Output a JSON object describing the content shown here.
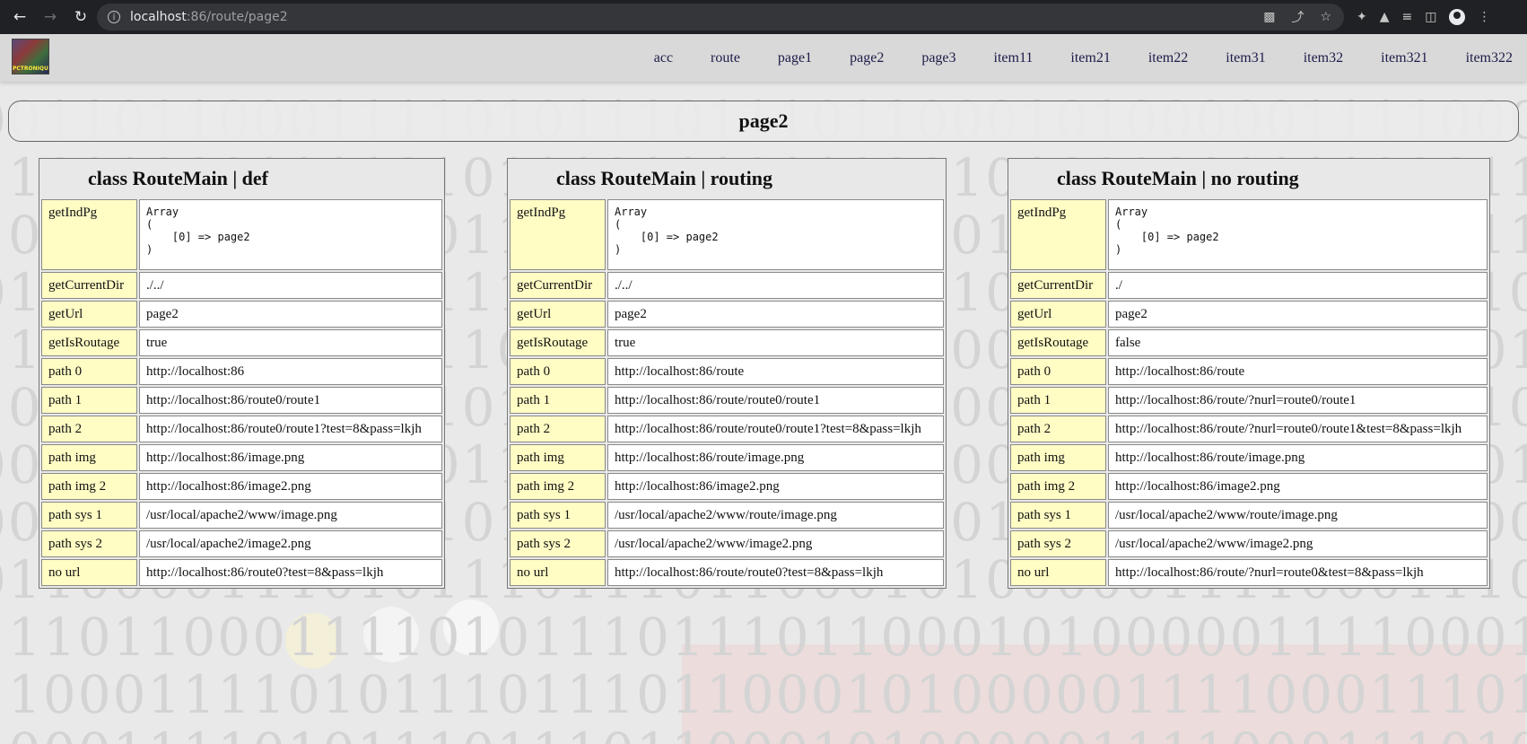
{
  "browser": {
    "url_host": "localhost",
    "url_rest": ":86/route/page2",
    "icons": [
      "back-arrow-icon",
      "forward-arrow-icon",
      "reload-icon",
      "info-icon",
      "translate-icon",
      "share-icon",
      "star-icon",
      "extensions-icon",
      "lab-icon",
      "reading-list-icon",
      "side-panel-icon",
      "profile-icon",
      "more-icon"
    ]
  },
  "header": {
    "logo_text": "PCTRONIQUE",
    "menu": [
      "acc",
      "route",
      "page1",
      "page2",
      "page3",
      "item11",
      "item21",
      "item22",
      "item31",
      "item32",
      "item321",
      "item322"
    ]
  },
  "page_title": "page2",
  "panels": [
    {
      "title": "class RouteMain | def",
      "array": "Array\n(\n    [0] => page2\n)",
      "rows": [
        {
          "key": "getCurrentDir",
          "value": "./../"
        },
        {
          "key": "getUrl",
          "value": "page2"
        },
        {
          "key": "getIsRoutage",
          "value": "true"
        },
        {
          "key": "path 0",
          "value": "http://localhost:86"
        },
        {
          "key": "path 1",
          "value": "http://localhost:86/route0/route1"
        },
        {
          "key": "path 2",
          "value": "http://localhost:86/route0/route1?test=8&pass=lkjh"
        },
        {
          "key": "path img",
          "value": "http://localhost:86/image.png"
        },
        {
          "key": "path img 2",
          "value": "http://localhost:86/image2.png"
        },
        {
          "key": "path sys 1",
          "value": "/usr/local/apache2/www/image.png"
        },
        {
          "key": "path sys 2",
          "value": "/usr/local/apache2/image2.png"
        },
        {
          "key": "no url",
          "value": "http://localhost:86/route0?test=8&pass=lkjh"
        }
      ]
    },
    {
      "title": "class RouteMain | routing",
      "array": "Array\n(\n    [0] => page2\n)",
      "rows": [
        {
          "key": "getCurrentDir",
          "value": "./../"
        },
        {
          "key": "getUrl",
          "value": "page2"
        },
        {
          "key": "getIsRoutage",
          "value": "true"
        },
        {
          "key": "path 0",
          "value": "http://localhost:86/route"
        },
        {
          "key": "path 1",
          "value": "http://localhost:86/route/route0/route1"
        },
        {
          "key": "path 2",
          "value": "http://localhost:86/route/route0/route1?test=8&pass=lkjh"
        },
        {
          "key": "path img",
          "value": "http://localhost:86/route/image.png"
        },
        {
          "key": "path img 2",
          "value": "http://localhost:86/image2.png"
        },
        {
          "key": "path sys 1",
          "value": "/usr/local/apache2/www/route/image.png"
        },
        {
          "key": "path sys 2",
          "value": "/usr/local/apache2/www/image2.png"
        },
        {
          "key": "no url",
          "value": "http://localhost:86/route/route0?test=8&pass=lkjh"
        }
      ]
    },
    {
      "title": "class RouteMain | no routing",
      "array": "Array\n(\n    [0] => page2\n)",
      "rows": [
        {
          "key": "getCurrentDir",
          "value": "./"
        },
        {
          "key": "getUrl",
          "value": "page2"
        },
        {
          "key": "getIsRoutage",
          "value": "false"
        },
        {
          "key": "path 0",
          "value": "http://localhost:86/route"
        },
        {
          "key": "path 1",
          "value": "http://localhost:86/route/?nurl=route0/route1"
        },
        {
          "key": "path 2",
          "value": "http://localhost:86/route/?nurl=route0/route1&test=8&pass=lkjh"
        },
        {
          "key": "path img",
          "value": "http://localhost:86/route/image.png"
        },
        {
          "key": "path img 2",
          "value": "http://localhost:86/image2.png"
        },
        {
          "key": "path sys 1",
          "value": "/usr/local/apache2/www/route/image.png"
        },
        {
          "key": "path sys 2",
          "value": "/usr/local/apache2/www/image2.png"
        },
        {
          "key": "no url",
          "value": "http://localhost:86/route/?nurl=route0&test=8&pass=lkjh"
        }
      ]
    }
  ],
  "array_key": "getIndPg",
  "colors": {
    "true": "#1a8a1a",
    "false": "#e02020",
    "key_cell": "#fffcc4"
  }
}
